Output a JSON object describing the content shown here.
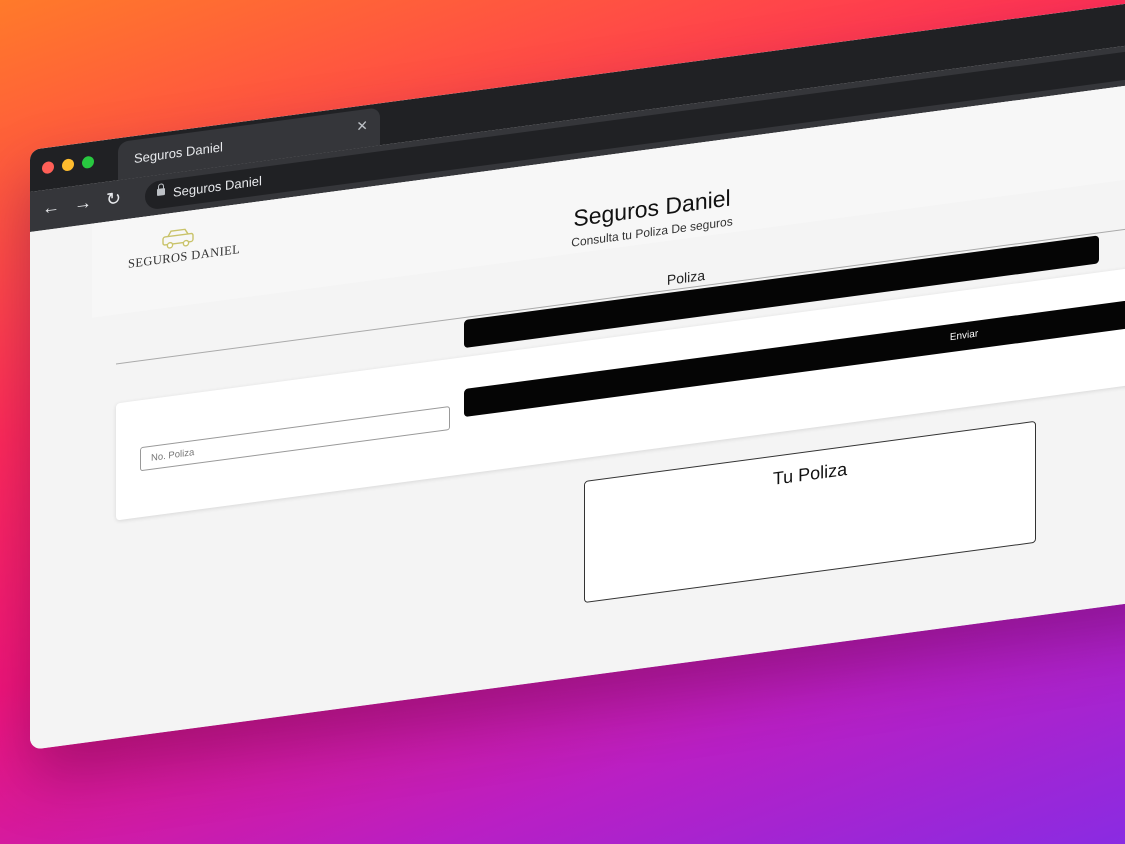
{
  "browser": {
    "tab_title": "Seguros Daniel",
    "address": "Seguros Daniel",
    "close_glyph": "✕",
    "back_glyph": "←",
    "forward_glyph": "→",
    "reload_glyph": "↻"
  },
  "header": {
    "logo_text": "SEGUROS DANIEL",
    "title": "Seguros Daniel",
    "subtitle": "Consulta tu Poliza De seguros"
  },
  "form": {
    "section_title": "Poliza",
    "input_placeholder": "No. Poliza",
    "submit_label": "Enviar"
  },
  "result": {
    "title": "Tu Poliza"
  },
  "colors": {
    "button_bg": "#050505",
    "logo_accent": "#c9c36a"
  }
}
